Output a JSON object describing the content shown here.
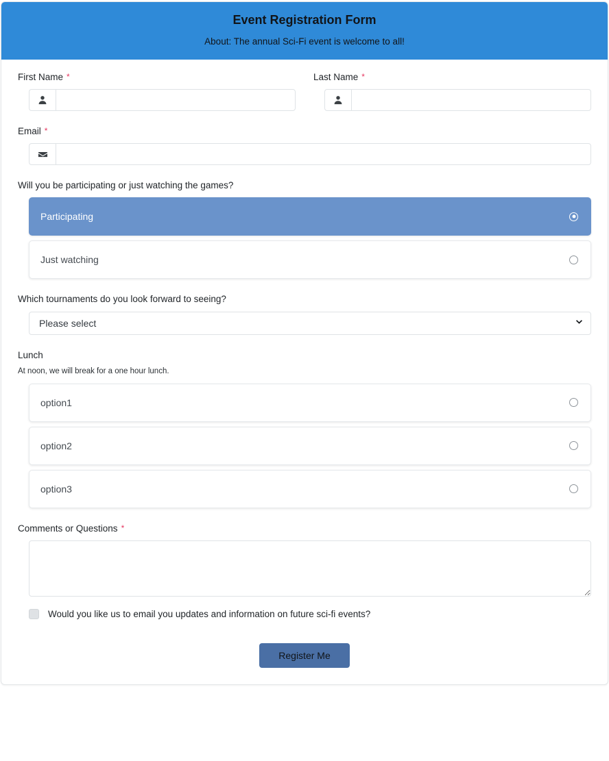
{
  "header": {
    "title": "Event Registration Form",
    "subtitle": "About: The annual Sci-Fi event is welcome to all!",
    "background_color": "#2f8ad8"
  },
  "theme": {
    "header_blue": "#2f8ad8",
    "selected_option_blue": "#6a93cb",
    "submit_button_blue": "#4a6fa5",
    "required_asterisk_color": "#e6365f"
  },
  "fields": {
    "first_name": {
      "label": "First Name",
      "required_mark": "*",
      "icon": "person-icon",
      "value": "",
      "placeholder": ""
    },
    "last_name": {
      "label": "Last Name",
      "required_mark": "*",
      "icon": "person-icon",
      "value": "",
      "placeholder": ""
    },
    "email": {
      "label": "Email",
      "required_mark": "*",
      "icon": "envelope-icon",
      "value": "",
      "placeholder": ""
    },
    "participation": {
      "label": "Will you be participating or just watching the games?",
      "options": [
        {
          "label": "Participating",
          "selected": true
        },
        {
          "label": "Just watching",
          "selected": false
        }
      ]
    },
    "tournaments": {
      "label": "Which tournaments do you look forward to seeing?",
      "selected_value": "Please select",
      "caret_icon": "chevron-down-icon"
    },
    "lunch": {
      "label": "Lunch",
      "helper_text": "At noon, we will break for a one hour lunch.",
      "options": [
        {
          "label": "option1",
          "selected": false
        },
        {
          "label": "option2",
          "selected": false
        },
        {
          "label": "option3",
          "selected": false
        }
      ]
    },
    "comments": {
      "label": "Comments or Questions",
      "required_mark": "*",
      "value": "",
      "placeholder": ""
    },
    "email_updates": {
      "label": "Would you like us to email you updates and information on future sci-fi events?",
      "checked": false
    }
  },
  "submit": {
    "label": "Register Me"
  }
}
